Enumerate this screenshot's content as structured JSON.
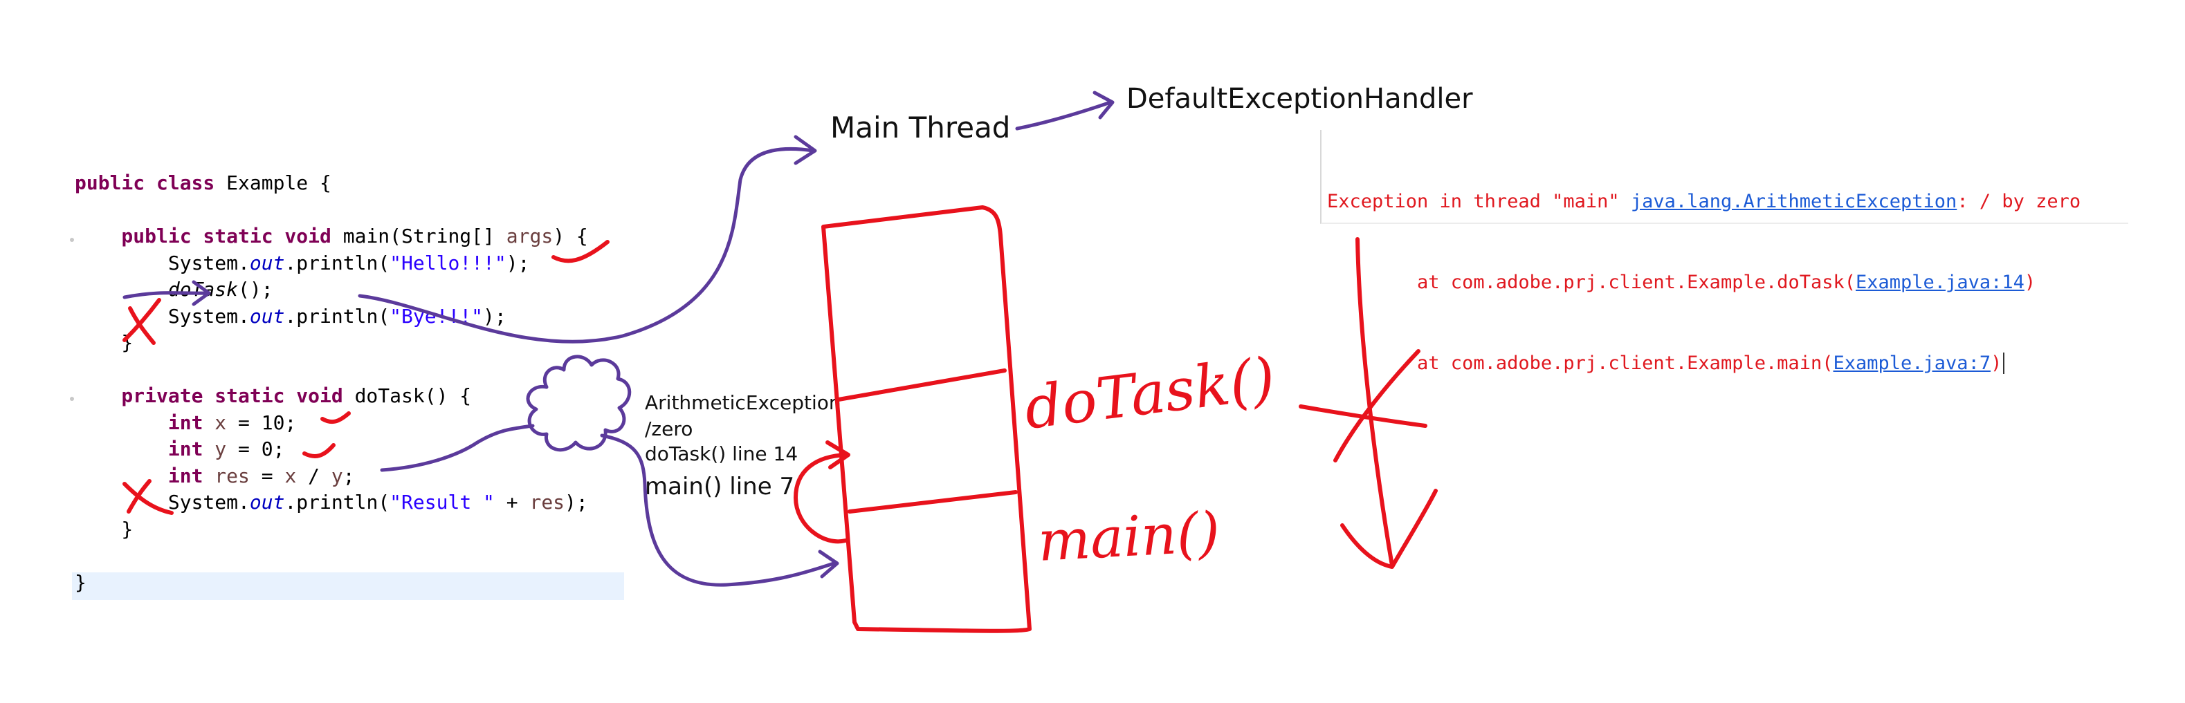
{
  "code": {
    "lines": [
      [
        {
          "t": "public class ",
          "c": "kw"
        },
        {
          "t": "Example {"
        }
      ],
      [],
      [
        {
          "t": "    public static void ",
          "c": "kw"
        },
        {
          "t": "main(String[] "
        },
        {
          "t": "args",
          "c": "var"
        },
        {
          "t": ") {"
        }
      ],
      [
        {
          "t": "        System."
        },
        {
          "t": "out",
          "c": "fld"
        },
        {
          "t": ".println("
        },
        {
          "t": "\"Hello!!!\"",
          "c": "str"
        },
        {
          "t": ");"
        }
      ],
      [
        {
          "t": "        "
        },
        {
          "t": "doTask",
          "c": "mcall"
        },
        {
          "t": "();"
        }
      ],
      [
        {
          "t": "        System."
        },
        {
          "t": "out",
          "c": "fld"
        },
        {
          "t": ".println("
        },
        {
          "t": "\"Bye!!!\"",
          "c": "str"
        },
        {
          "t": ");"
        }
      ],
      [
        {
          "t": "    }"
        }
      ],
      [],
      [
        {
          "t": "    private static void ",
          "c": "kw"
        },
        {
          "t": "doTask() {"
        }
      ],
      [
        {
          "t": "        int ",
          "c": "kw"
        },
        {
          "t": "x",
          "c": "var"
        },
        {
          "t": " = 10;"
        }
      ],
      [
        {
          "t": "        int ",
          "c": "kw"
        },
        {
          "t": "y",
          "c": "var"
        },
        {
          "t": " = 0;"
        }
      ],
      [
        {
          "t": "        int ",
          "c": "kw"
        },
        {
          "t": "res",
          "c": "var"
        },
        {
          "t": " = "
        },
        {
          "t": "x",
          "c": "var"
        },
        {
          "t": " / "
        },
        {
          "t": "y",
          "c": "var"
        },
        {
          "t": ";"
        }
      ],
      [
        {
          "t": "        System."
        },
        {
          "t": "out",
          "c": "fld"
        },
        {
          "t": ".println("
        },
        {
          "t": "\"Result \"",
          "c": "str"
        },
        {
          "t": " + "
        },
        {
          "t": "res",
          "c": "var"
        },
        {
          "t": ");"
        }
      ],
      [
        {
          "t": "    }"
        }
      ],
      [],
      [
        {
          "t": "}"
        }
      ]
    ]
  },
  "notes": {
    "main_thread": "Main Thread",
    "default_handler": "DefaultExceptionHandler",
    "exception_name": "ArithmeticException",
    "exception_detail": "/zero",
    "trace_dotask": "doTask() line 14",
    "trace_main": "main() line 7"
  },
  "stack": {
    "frame_top": "doTask()",
    "frame_bottom": "main()"
  },
  "console": {
    "line1_prefix": "Exception in thread \"main\" ",
    "line1_link": "java.lang.ArithmeticException",
    "line1_suffix": ": / by zero",
    "line2_prefix": "        at com.adobe.prj.client.Example.doTask(",
    "line2_link": "Example.java:14",
    "line2_suffix": ")",
    "line3_prefix": "        at com.adobe.prj.client.Example.main(",
    "line3_link": "Example.java:7",
    "line3_suffix": ")"
  },
  "colors": {
    "keyword": "#7f0055",
    "string": "#2a00ff",
    "field": "#0000c0",
    "ink_purple": "#5b3a9b",
    "ink_red": "#e8121c",
    "console_error": "#e0181f",
    "console_link": "#1c5bd6"
  }
}
